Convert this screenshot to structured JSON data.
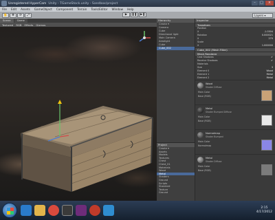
{
  "window": {
    "title": "Unregistered HyperCam",
    "subtitle": "Unity - TGameStock.unity - Sandbox/project",
    "controls": [
      "–",
      "□",
      "×"
    ]
  },
  "menu": [
    "File",
    "Edit",
    "Assets",
    "GameObject",
    "Component",
    "Terrain",
    "Tools/Editor",
    "Window",
    "Help"
  ],
  "toolbar": {
    "tools": [
      "✋",
      "✥",
      "⟳",
      "⤢"
    ],
    "play": [
      "▶",
      "❚❚",
      "▶❚"
    ],
    "layout": "Layers ▾"
  },
  "scene": {
    "tabs": [
      "Scene",
      "Game"
    ],
    "bar_items": [
      "Textured",
      "RGB",
      "Effects",
      "Gizmos"
    ]
  },
  "hierarchy": {
    "header": "Hierarchy",
    "rows": [
      "Create ▾",
      "Camera",
      "Cube",
      "Directional light",
      "Main Camera",
      "Arealight",
      "",
      "Cube",
      "Cube_002"
    ],
    "selected_index": 8
  },
  "project": {
    "header": "Project",
    "rows": [
      "Create ▾",
      "Assets",
      "Models",
      "Textures",
      "Chest",
      "Chest_01",
      "Materials",
      "Wood",
      "Metal",
      "Shaders",
      "Ground",
      "Scripts",
      "Standard",
      "Texture",
      "Ground"
    ],
    "selected_index": 8
  },
  "inspector": {
    "header": "Inspector",
    "transform": {
      "title": "Transform",
      "fields": [
        {
          "label": "Position",
          "value": ""
        },
        {
          "label": "X",
          "value": "-1.0304"
        },
        {
          "label": "Rotation",
          "value": "0.000021"
        },
        {
          "label": "X",
          "value": "270"
        },
        {
          "label": "Scale",
          "value": ""
        },
        {
          "label": "X",
          "value": "1.000000"
        }
      ]
    },
    "meshfilter": {
      "title": "Cube_002 (Mesh Filter)",
      "mesh": "Cube_002"
    },
    "renderer": {
      "title": "Mesh Renderer",
      "fields": [
        {
          "label": "Cast Shadows",
          "value": "✔"
        },
        {
          "label": "Receive Shadows",
          "value": "✔"
        },
        {
          "label": "Materials",
          "value": ""
        },
        {
          "label": "Size",
          "value": "3"
        },
        {
          "label": "Element 0",
          "value": "Wood"
        },
        {
          "label": "Element 1",
          "value": "Metal"
        },
        {
          "label": "Element 2",
          "value": "Metal"
        }
      ]
    },
    "materials": [
      {
        "name": "Wood",
        "shader": "Shader  Diffuse",
        "base": "Main Color",
        "tex_label": "Base (RGB)",
        "tex_color": "#c9a277"
      },
      {
        "name": "Metal",
        "shader": "Shader  Bumped Diffuse",
        "base": "Main Color",
        "tex_label": "Base (RGB)",
        "tex_color": "#e8e8e8"
      },
      {
        "name": "Normalmap",
        "shader": "Shader  Bumped",
        "base": "Main Color",
        "tex_label": "Normalmap",
        "tex_color": "#8a86e6"
      },
      {
        "name": "Metal",
        "shader": "Shader  Diffuse",
        "base": "Main Color",
        "tex_label": "Base (RGB)",
        "tex_color": "#7b7b7b"
      }
    ]
  },
  "taskbar": {
    "time": "2:15",
    "date": "4/17/2012",
    "apps": [
      {
        "name": "start",
        "color": "#1d4e8a"
      },
      {
        "name": "media",
        "color": "#2a7bcc"
      },
      {
        "name": "folder",
        "color": "#e2b44b"
      },
      {
        "name": "chrome",
        "color": "#d94a3d"
      },
      {
        "name": "unity",
        "color": "#3a3a3a"
      },
      {
        "name": "steam",
        "color": "#6e2c7a"
      },
      {
        "name": "recorder",
        "color": "#c03b2a"
      },
      {
        "name": "editor",
        "color": "#2f8dd0"
      }
    ]
  }
}
